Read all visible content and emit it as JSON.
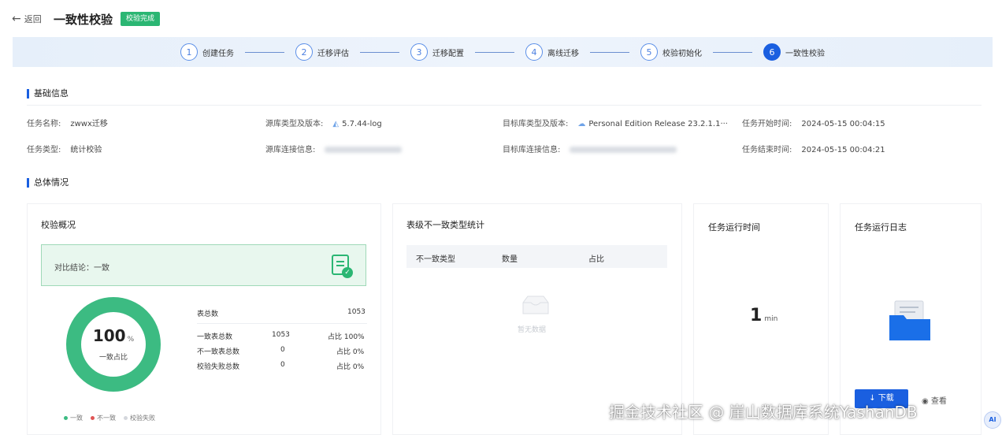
{
  "header": {
    "back_label": "返回",
    "title": "一致性校验",
    "status_badge": "校验完成"
  },
  "stepper": {
    "steps": [
      {
        "num": "1",
        "label": "创建任务"
      },
      {
        "num": "2",
        "label": "迁移评估"
      },
      {
        "num": "3",
        "label": "迁移配置"
      },
      {
        "num": "4",
        "label": "离线迁移"
      },
      {
        "num": "5",
        "label": "校验初始化"
      },
      {
        "num": "6",
        "label": "一致性校验"
      }
    ],
    "active_step": 6
  },
  "basic_info": {
    "section_title": "基础信息",
    "task_name_label": "任务名称:",
    "task_name_value": "zwwx迁移",
    "source_type_label": "源库类型及版本:",
    "source_type_value": "5.7.44-log",
    "target_type_label": "目标库类型及版本:",
    "target_type_value": "Personal Edition Release 23.2.1.1···",
    "start_time_label": "任务开始时间:",
    "start_time_value": "2024-05-15 00:04:15",
    "task_type_label": "任务类型:",
    "task_type_value": "统计校验",
    "source_conn_label": "源库连接信息:",
    "target_conn_label": "目标库连接信息:",
    "end_time_label": "任务结束时间:",
    "end_time_value": "2024-05-15 00:04:21"
  },
  "overview": {
    "section_title": "总体情况",
    "check_summary": {
      "title": "校验概况",
      "conclusion": "对比结论：一致",
      "donut_value": "100",
      "donut_unit": "%",
      "donut_label": "一致占比",
      "consistent_fraction": 1.0,
      "total_label": "表总数",
      "total_value": "1053",
      "rows": [
        {
          "label": "一致表总数",
          "count": "1053",
          "ratio": "占比 100%"
        },
        {
          "label": "不一致表总数",
          "count": "0",
          "ratio": "占比 0%"
        },
        {
          "label": "校验失败总数",
          "count": "0",
          "ratio": "占比 0%"
        }
      ],
      "legend": [
        "一致",
        "不一致",
        "校验失败"
      ]
    },
    "mismatch_stats": {
      "title": "表级不一致类型统计",
      "columns": [
        "不一致类型",
        "数量",
        "占比"
      ],
      "empty_text": "暂无数据"
    },
    "run_time": {
      "title": "任务运行时间",
      "value": "1",
      "unit": "min"
    },
    "run_log": {
      "title": "任务运行日志",
      "download_label": "下载",
      "view_label": "查看"
    }
  },
  "watermark": "掘金技术社区 @ 崖山数据库系统YashanDB",
  "ai_badge": "AI",
  "colors": {
    "primary": "#1a5fe0",
    "success": "#2bb673",
    "donut": "#3cbb82",
    "fail": "#e05555"
  }
}
